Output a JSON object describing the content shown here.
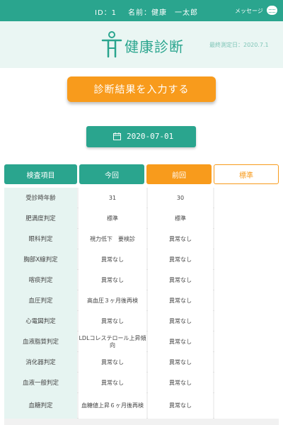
{
  "topbar": {
    "id_text": "ID：1",
    "name_text": "名前：健康　一太郎",
    "message_label": "メッセージ",
    "message_icon": "chat-bubble-icon"
  },
  "header": {
    "title": "健康診断",
    "logo_icon": "person-figure-icon",
    "last_measured": "最終測定日：2020.7.1"
  },
  "actions": {
    "enter_results_label": "診断結果を入力する",
    "date_value": "2020-07-01",
    "date_icon": "calendar-icon"
  },
  "columns": {
    "item": "検査項目",
    "current": "今回",
    "previous": "前回",
    "standard": "標準"
  },
  "rows": [
    {
      "item": "受診時年齢",
      "current": "31",
      "previous": "30",
      "standard": ""
    },
    {
      "item": "肥満度判定",
      "current": "標準",
      "previous": "標準",
      "standard": ""
    },
    {
      "item": "眼科判定",
      "current": "視力低下　要検診",
      "previous": "異常なし",
      "standard": ""
    },
    {
      "item": "胸部X線判定",
      "current": "異常なし",
      "previous": "異常なし",
      "standard": ""
    },
    {
      "item": "喀痰判定",
      "current": "異常なし",
      "previous": "異常なし",
      "standard": ""
    },
    {
      "item": "血圧判定",
      "current": "高血圧３ヶ月後再検",
      "previous": "異常なし",
      "standard": ""
    },
    {
      "item": "心電図判定",
      "current": "異常なし",
      "previous": "異常なし",
      "standard": ""
    },
    {
      "item": "血液脂質判定",
      "current": "LDLコレステロール上昇傾向",
      "previous": "異常なし",
      "standard": ""
    },
    {
      "item": "消化器判定",
      "current": "異常なし",
      "previous": "異常なし",
      "standard": ""
    },
    {
      "item": "血液一般判定",
      "current": "異常なし",
      "previous": "異常なし",
      "standard": ""
    },
    {
      "item": "血糖判定",
      "current": "血糖値上昇６ヶ月後再検",
      "previous": "異常なし",
      "standard": ""
    }
  ],
  "colors": {
    "teal": "#2aa58e",
    "orange": "#f89b1c",
    "header_bg": "#eaf6f3"
  }
}
